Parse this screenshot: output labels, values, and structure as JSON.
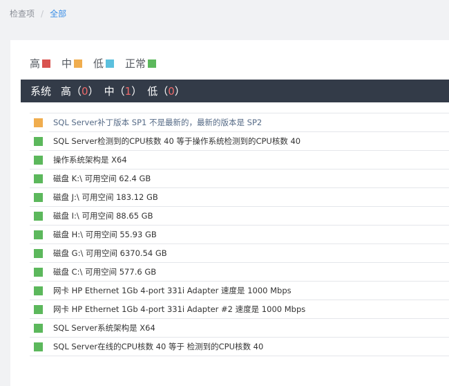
{
  "breadcrumb": {
    "root": "检查项",
    "separator": "/",
    "current": "全部"
  },
  "colors": {
    "high": "#d9534f",
    "medium": "#f0ad4e",
    "low": "#5bc0de",
    "normal": "#5cb85c"
  },
  "legend": [
    {
      "label": "高",
      "level": "high"
    },
    {
      "label": "中",
      "level": "medium"
    },
    {
      "label": "低",
      "level": "low"
    },
    {
      "label": "正常",
      "level": "normal"
    }
  ],
  "section": {
    "title": "系统",
    "high_label": "高",
    "high_count": "0",
    "medium_label": "中",
    "medium_count": "1",
    "low_label": "低",
    "low_count": "0"
  },
  "items": [
    {
      "level": "medium",
      "text": "SQL Server补丁版本 SP1 不是最新的，最新的版本是 SP2"
    },
    {
      "level": "normal",
      "text": "SQL Server检测到的CPU核数 40 等于操作系统检测到的CPU核数 40"
    },
    {
      "level": "normal",
      "text": "操作系统架构是 X64"
    },
    {
      "level": "normal",
      "text": "磁盘 K:\\ 可用空间 62.4 GB"
    },
    {
      "level": "normal",
      "text": "磁盘 J:\\ 可用空间 183.12 GB"
    },
    {
      "level": "normal",
      "text": "磁盘 I:\\ 可用空间 88.65 GB"
    },
    {
      "level": "normal",
      "text": "磁盘 H:\\ 可用空间 55.93 GB"
    },
    {
      "level": "normal",
      "text": "磁盘 G:\\ 可用空间 6370.54 GB"
    },
    {
      "level": "normal",
      "text": "磁盘 C:\\ 可用空间 577.6 GB"
    },
    {
      "level": "normal",
      "text": "网卡 HP Ethernet 1Gb 4-port 331i Adapter 速度是 1000 Mbps"
    },
    {
      "level": "normal",
      "text": "网卡 HP Ethernet 1Gb 4-port 331i Adapter #2 速度是 1000 Mbps"
    },
    {
      "level": "normal",
      "text": "SQL Server系统架构是 X64"
    },
    {
      "level": "normal",
      "text": "SQL Server在线的CPU核数 40 等于 检测到的CPU核数 40"
    }
  ]
}
